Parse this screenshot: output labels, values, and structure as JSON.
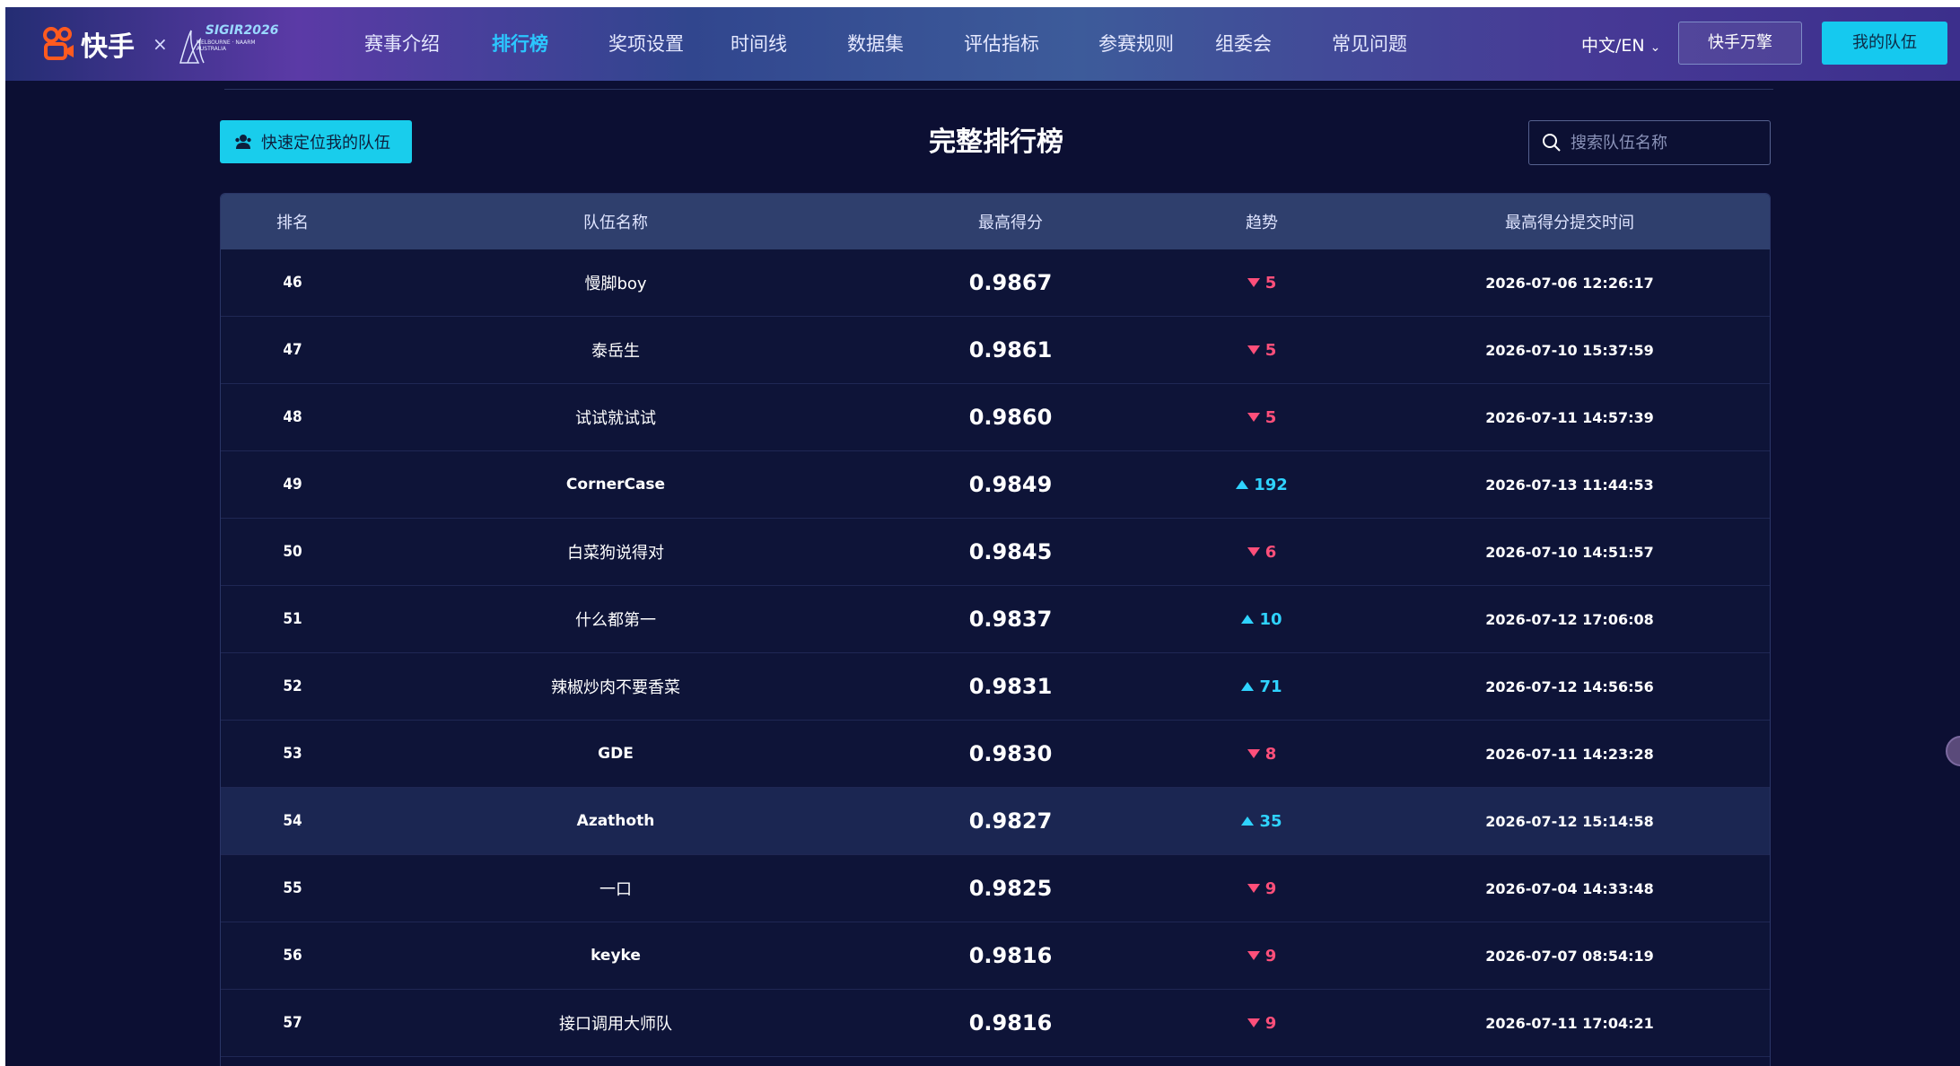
{
  "header": {
    "brand_text": "快手",
    "brand_x": "×",
    "sigir_main": "SIGIR2026",
    "sigir_sub1": "MELBOURNE · NAARM",
    "sigir_sub2": "AUSTRALIA",
    "nav": [
      {
        "label": "赛事介绍",
        "active": false
      },
      {
        "label": "排行榜",
        "active": true
      },
      {
        "label": "奖项设置",
        "active": false
      },
      {
        "label": "时间线",
        "active": false
      },
      {
        "label": "数据集",
        "active": false
      },
      {
        "label": "评估指标",
        "active": false
      },
      {
        "label": "参赛规则",
        "active": false
      },
      {
        "label": "组委会",
        "active": false
      },
      {
        "label": "常见问题",
        "active": false
      }
    ],
    "lang": "中文/EN",
    "kwai_button": "快手万擎",
    "myteam_button": "我的队伍"
  },
  "toolbar": {
    "locate_button": "快速定位我的队伍",
    "title": "完整排行榜",
    "search_placeholder": "搜索队伍名称"
  },
  "table": {
    "columns": [
      "排名",
      "队伍名称",
      "最高得分",
      "趋势",
      "最高得分提交时间"
    ],
    "rows": [
      {
        "rank": "46",
        "name": "慢脚boy",
        "score": "0.9867",
        "dir": "down",
        "trend": "5",
        "time": "2026-07-06 12:26:17"
      },
      {
        "rank": "47",
        "name": "泰岳生",
        "score": "0.9861",
        "dir": "down",
        "trend": "5",
        "time": "2026-07-10 15:37:59"
      },
      {
        "rank": "48",
        "name": "试试就试试",
        "score": "0.9860",
        "dir": "down",
        "trend": "5",
        "time": "2026-07-11 14:57:39"
      },
      {
        "rank": "49",
        "name": "CornerCase",
        "score": "0.9849",
        "dir": "up",
        "trend": "192",
        "time": "2026-07-13 11:44:53"
      },
      {
        "rank": "50",
        "name": "白菜狗说得对",
        "score": "0.9845",
        "dir": "down",
        "trend": "6",
        "time": "2026-07-10 14:51:57"
      },
      {
        "rank": "51",
        "name": "什么都第一",
        "score": "0.9837",
        "dir": "up",
        "trend": "10",
        "time": "2026-07-12 17:06:08"
      },
      {
        "rank": "52",
        "name": "辣椒炒肉不要香菜",
        "score": "0.9831",
        "dir": "up",
        "trend": "71",
        "time": "2026-07-12 14:56:56"
      },
      {
        "rank": "53",
        "name": "GDE",
        "score": "0.9830",
        "dir": "down",
        "trend": "8",
        "time": "2026-07-11 14:23:28"
      },
      {
        "rank": "54",
        "name": "Azathoth",
        "score": "0.9827",
        "dir": "up",
        "trend": "35",
        "time": "2026-07-12 15:14:58"
      },
      {
        "rank": "55",
        "name": "一口",
        "score": "0.9825",
        "dir": "down",
        "trend": "9",
        "time": "2026-07-04 14:33:48"
      },
      {
        "rank": "56",
        "name": "keyke",
        "score": "0.9816",
        "dir": "down",
        "trend": "9",
        "time": "2026-07-07 08:54:19"
      },
      {
        "rank": "57",
        "name": "接口调用大师队",
        "score": "0.9816",
        "dir": "down",
        "trend": "9",
        "time": "2026-07-11 17:04:21"
      }
    ],
    "highlight_rank": "54"
  },
  "colors": {
    "accent": "#19cdec",
    "down": "#ff4f7a",
    "up": "#2fd3ff",
    "background": "#0c0f33"
  }
}
